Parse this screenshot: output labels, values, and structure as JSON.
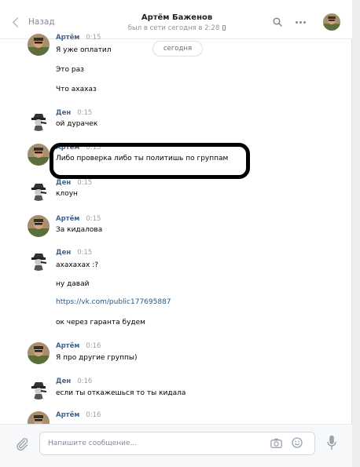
{
  "header": {
    "back_label": "Назад",
    "title": "Артём Баженов",
    "subtitle": "был в сети сегодня в 2:28"
  },
  "date_divider": "сегодня",
  "messages": [
    {
      "author": "Артём",
      "time": "0:15",
      "lines": [
        "Я уже оплатил",
        "Это раз",
        "Что ахахаз"
      ]
    },
    {
      "author": "Ден",
      "time": "0:15",
      "lines": [
        "ой дурачек"
      ]
    },
    {
      "author": "Артём",
      "time": "0:15",
      "lines": [
        "Либо проверка либо ты политишь по группам"
      ]
    },
    {
      "author": "Ден",
      "time": "0:15",
      "lines": [
        "клоун"
      ]
    },
    {
      "author": "Артём",
      "time": "0:15",
      "lines": [
        "За кидалова"
      ]
    },
    {
      "author": "Ден",
      "time": "0:15",
      "lines": [
        "ахахахах :?",
        "ну давай",
        "https://vk.com/public177695887",
        "ок через гаранта будем"
      ]
    },
    {
      "author": "Артём",
      "time": "0:16",
      "lines": [
        "Я про другие группы)"
      ]
    },
    {
      "author": "Ден",
      "time": "0:16",
      "lines": [
        "если ты откажешься то ты кидала"
      ]
    },
    {
      "author": "Артём",
      "time": "0:16",
      "lines": []
    }
  ],
  "compose": {
    "placeholder": "Напишите сообщение..."
  },
  "colors": {
    "name": "#42648b",
    "link": "#2a5885",
    "time": "#a0a0a0"
  }
}
